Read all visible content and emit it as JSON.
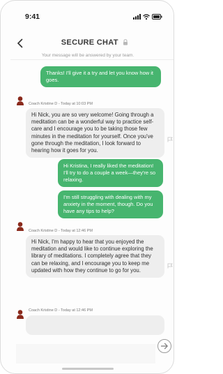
{
  "status_bar": {
    "time": "9:41"
  },
  "header": {
    "title": "SECURE CHAT",
    "subtitle": "Your message will be answered by your team.",
    "back_icon": "chevron-left-icon",
    "lock_icon": "lock-icon"
  },
  "messages": [
    {
      "direction": "out",
      "text": "Thanks! I'll give it a try and let you know how it goes."
    },
    {
      "direction": "in",
      "meta": "Coach Kristine D - Today at 10:03 PM",
      "text": "Hi Nick, you are so very welcome! Going through a meditation can be a wonderful way to practice self-care and I encourage you to be taking those few minutes in the meditation for yourself. Once you've gone through the meditation, I look forward to hearing how it goes for you."
    },
    {
      "direction": "out",
      "text": "Hi Kristina, I really liked the meditation! I'll try to do a couple a week—they're so relaxing."
    },
    {
      "direction": "out",
      "text": "I'm still struggling with dealing with my anxiety in the moment, though. Do you have any tips to help?"
    },
    {
      "direction": "in",
      "meta": "Coach Kristine D - Today at 12:46 PM",
      "text": "Hi Nick, I'm happy to hear that you enjoyed the meditation and would like to continue exploring the library of meditations. I completely agree that they can be relaxing, and I encourage you to keep me updated with how they continue to go for you."
    },
    {
      "direction": "in",
      "meta": "Coach Kristine D - Today at 12:46 PM",
      "text": ""
    }
  ],
  "compose": {
    "placeholder": "",
    "send_icon": "send-arrow-icon"
  },
  "colors": {
    "outgoing_bubble": "#47b56f",
    "incoming_bubble": "#eeeeee",
    "avatar": "#8a2a1c"
  }
}
